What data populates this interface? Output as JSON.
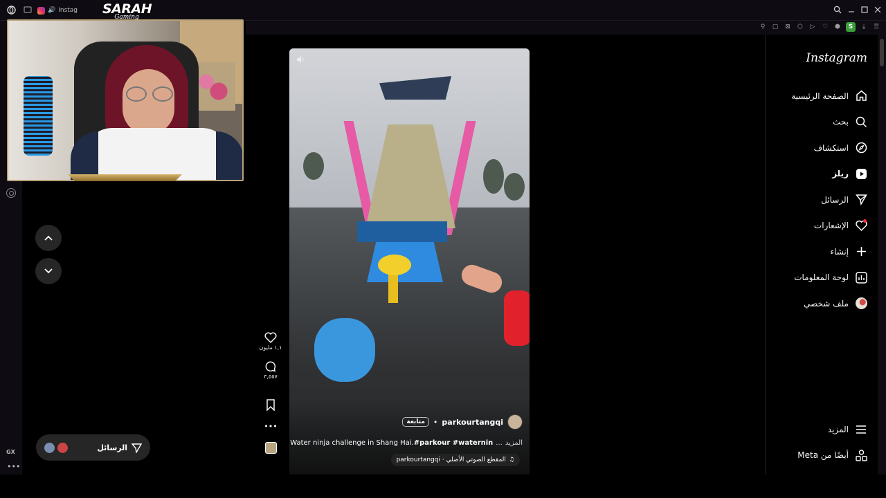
{
  "browser": {
    "tab_title": "Instag",
    "brand_label": "GX"
  },
  "stream": {
    "logo_main": "SARAH",
    "logo_sub": "Gaming"
  },
  "instagram": {
    "wordmark": "Instagram",
    "nav": [
      {
        "label": "الصفحة الرئيسية",
        "icon": "home-icon"
      },
      {
        "label": "بحث",
        "icon": "search-icon"
      },
      {
        "label": "استكشاف",
        "icon": "explore-icon"
      },
      {
        "label": "ريلز",
        "icon": "reels-icon",
        "active": true
      },
      {
        "label": "الرسائل",
        "icon": "messages-icon"
      },
      {
        "label": "الإشعارات",
        "icon": "heart-icon"
      },
      {
        "label": "إنشاء",
        "icon": "plus-icon"
      },
      {
        "label": "لوحة المعلومات",
        "icon": "dashboard-icon"
      },
      {
        "label": "ملف شخصي",
        "icon": "avatar-icon"
      }
    ],
    "nav_bottom": [
      {
        "label": "المزيد",
        "icon": "menu-icon"
      },
      {
        "label": "أيضًا من Meta",
        "icon": "meta-apps-icon"
      }
    ],
    "messages_pill_label": "الرسائل"
  },
  "reel": {
    "author": "parkourtangqi",
    "separator": "•",
    "follow_label": "متابعة",
    "caption_prefix": "Water ninja challenge in Shang Hai.",
    "caption_tags": "#parkour #waternin",
    "caption_ellipsis": "...",
    "caption_more": "المزيد",
    "audio_label": "المقطع الصوتي الأصلي · parkourtangqi",
    "likes": "١,١ مليون",
    "comments": "٣,٥٥٧"
  },
  "colors": {
    "accent_reels": "#ffffff",
    "notification_dot": "#ff3040",
    "background": "#000000"
  }
}
